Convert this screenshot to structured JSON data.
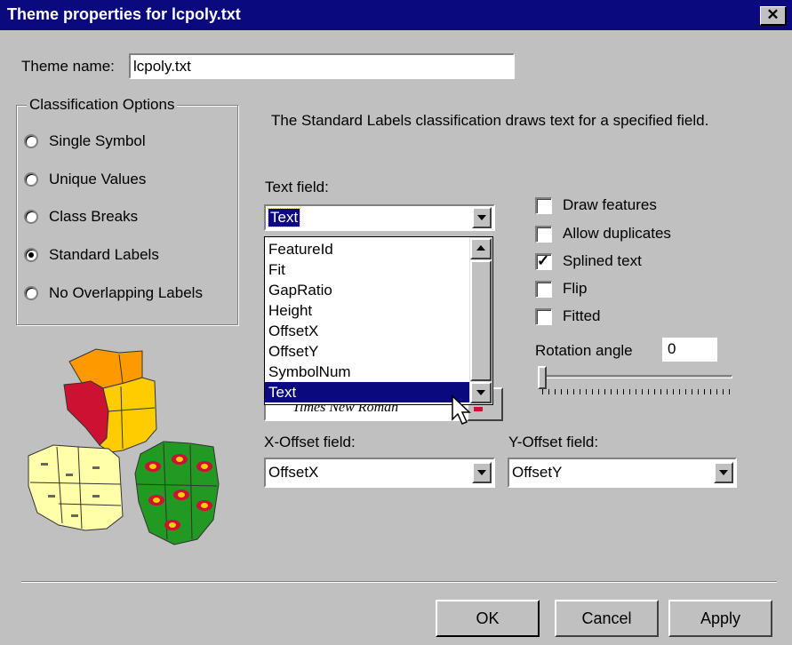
{
  "window": {
    "title": "Theme properties for lcpoly.txt",
    "close_glyph": "✕"
  },
  "theme_name": {
    "label": "Theme name:",
    "value": "lcpoly.txt"
  },
  "classification": {
    "group_label": "Classification Options",
    "options": [
      {
        "label": "Single Symbol",
        "selected": false
      },
      {
        "label": "Unique Values",
        "selected": false
      },
      {
        "label": "Class Breaks",
        "selected": false
      },
      {
        "label": "Standard Labels",
        "selected": true
      },
      {
        "label": "No Overlapping Labels",
        "selected": false
      }
    ]
  },
  "description": "The Standard Labels classification draws text for a specified field.",
  "text_field": {
    "label": "Text field:",
    "value": "Text",
    "dropdown_items": [
      "FeatureId",
      "Fit",
      "GapRatio",
      "Height",
      "OffsetX",
      "OffsetY",
      "SymbolNum",
      "Text"
    ],
    "highlighted_item": "Text"
  },
  "font_preview_text": "Times New Roman",
  "options": [
    {
      "label": "Draw features",
      "checked": false
    },
    {
      "label": "Allow duplicates",
      "checked": false
    },
    {
      "label": "Splined text",
      "checked": true
    },
    {
      "label": "Flip",
      "checked": false
    },
    {
      "label": "Fitted",
      "checked": false
    }
  ],
  "rotation": {
    "label": "Rotation angle",
    "value": "0"
  },
  "x_offset": {
    "label": "X-Offset field:",
    "value": "OffsetX"
  },
  "y_offset": {
    "label": "Y-Offset field:",
    "value": "OffsetY"
  },
  "buttons": {
    "ok": "OK",
    "cancel": "Cancel",
    "apply": "Apply"
  },
  "colors": {
    "titlebar": "#0a0a7e",
    "highlight": "#0a0a7e",
    "map_orange": "#ff9900",
    "map_red": "#cc1133",
    "map_yellow": "#ffcc00",
    "map_cream": "#ffffaa",
    "map_green": "#229922"
  }
}
